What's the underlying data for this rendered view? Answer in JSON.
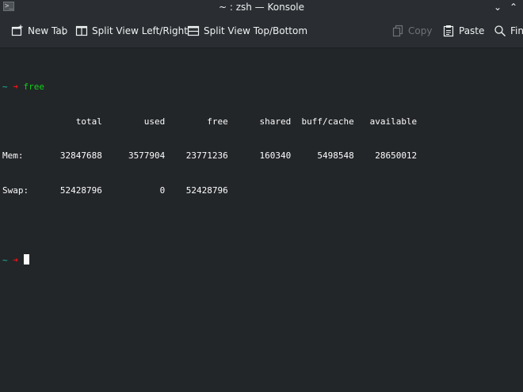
{
  "window": {
    "title": "~ : zsh — Konsole",
    "app_icon_glyph": ">_"
  },
  "titlebar_buttons": {
    "minimize": "⌄",
    "maximize": "⌃"
  },
  "toolbar": {
    "new_tab": "New Tab",
    "split_left_right": "Split View Left/Right",
    "split_top_bottom": "Split View Top/Bottom",
    "copy": "Copy",
    "paste": "Paste",
    "find": "Find"
  },
  "terminal": {
    "prompt_tilde": "~",
    "prompt_arrow": "➜",
    "command": "free",
    "output": {
      "header": "              total        used        free      shared  buff/cache   available",
      "mem": "Mem:       32847688     3577904    23771236      160340     5498548    28650012",
      "swap": "Swap:      52428796           0    52428796"
    }
  },
  "colors": {
    "background": "#232629",
    "chrome": "#2a2e32",
    "prompt_tilde": "#1abc9c",
    "prompt_arrow": "#ed1515",
    "command": "#11d116",
    "text": "#fcfcfc"
  }
}
